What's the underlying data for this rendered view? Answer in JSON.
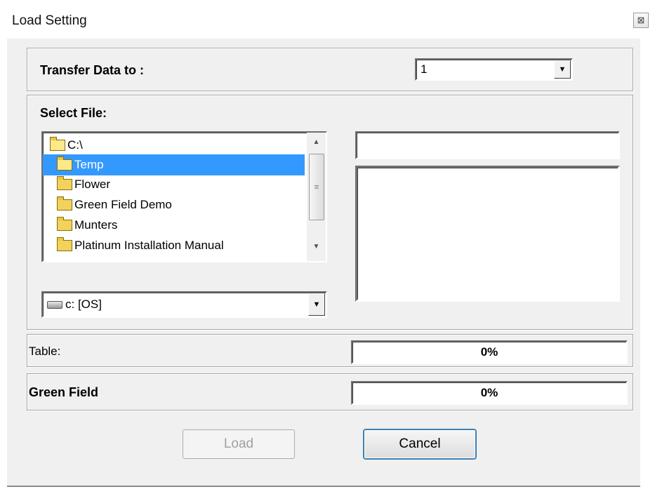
{
  "window": {
    "title": "Load Setting",
    "close_glyph": "⊠"
  },
  "transfer": {
    "label": "Transfer Data to :",
    "selected": "1"
  },
  "select_file": {
    "label": "Select File:",
    "tree": [
      {
        "label": "C:\\",
        "icon": "folder-open-icon",
        "selected": false
      },
      {
        "label": "Temp",
        "icon": "folder-open-icon",
        "selected": true
      },
      {
        "label": "Flower",
        "icon": "folder-icon",
        "selected": false
      },
      {
        "label": "Green Field Demo",
        "icon": "folder-icon",
        "selected": false
      },
      {
        "label": "Munters",
        "icon": "folder-icon",
        "selected": false
      },
      {
        "label": "Platinum Installation Manual",
        "icon": "folder-icon",
        "selected": false
      }
    ],
    "drive": "c: [OS]",
    "file_name": ""
  },
  "progress": {
    "table_label": "Table:",
    "table_value": "0%",
    "green_label": "Green Field",
    "green_value": "0%"
  },
  "buttons": {
    "load": "Load",
    "cancel": "Cancel"
  },
  "colors": {
    "selection": "#3399ff",
    "dialog_bg": "#f0f0f0"
  }
}
